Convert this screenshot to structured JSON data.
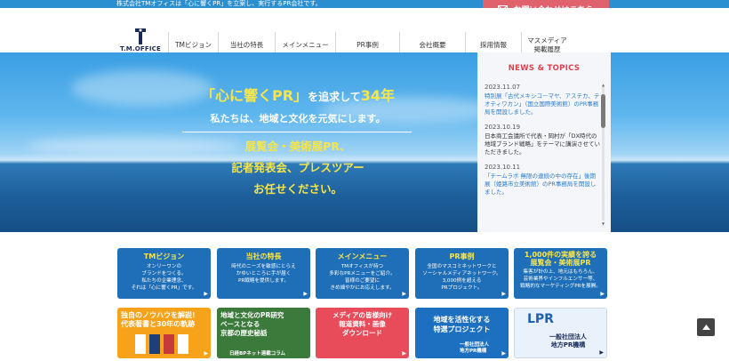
{
  "topbar": {
    "text": "株式会社TMオフィスは「心に響くPR」を立案し、実行するPR会社です。",
    "contact_label": "お問い合わせはこちら"
  },
  "logo": {
    "text": "T.M.OFFICE"
  },
  "nav": [
    {
      "label": "TMビジョン"
    },
    {
      "label": "当社の特長"
    },
    {
      "label": "メインメニュー"
    },
    {
      "label": "PR事例"
    },
    {
      "label": "会社概要"
    },
    {
      "label": "採用情報"
    },
    {
      "label": "マスメディア\n掲載履歴"
    }
  ],
  "hero": {
    "headline_pre": "「心に響くPR」",
    "headline_mid": "を追求して",
    "headline_post": "34年",
    "subline": "私たちは、地域と文化を元気にします。",
    "services": [
      "展覧会・美術展PR、",
      "記者発表会、プレスツアー",
      "お任せください。"
    ]
  },
  "news": {
    "title": "NEWS & TOPICS",
    "items": [
      {
        "date": "2023.11.07",
        "text": "特別展「古代メキシコ－マヤ、アステカ、テオティワカン」（国立国際美術館）のPR事務局を開設しました。",
        "link": true
      },
      {
        "date": "2023.10.19",
        "text": "日本商工会議所で代表・岡村が「DX時代の地域ブランド戦略」をテーマに講演させていただきました。",
        "link": false
      },
      {
        "date": "2023.10.11",
        "text": "「チームラボ 無限の連続の中の存在」後期展（姫路市立美術館）のPR事務局を開設しました。",
        "link": true
      }
    ]
  },
  "cards": [
    {
      "title": "TMビジョン",
      "body": "オンリーワンの\nブランドをつくる。\n私たちの企業理念、\nそれは「心に響くPR」です。"
    },
    {
      "title": "当社の特長",
      "body": "時代のニーズを敏感にとらえ\nかゆいところに手が届く\nPR戦略を提供します。"
    },
    {
      "title": "メインメニュー",
      "body": "TMオフィスが持つ\n多彩なPRメニューをご紹介。\n皆様のご要望に\nきめ細やかにお応えします。"
    },
    {
      "title": "PR事例",
      "body": "全国のマスコミネットワークと\nソーシャルメディアネットワーク。\n3,000例を超える\nPRプロジェクト。"
    },
    {
      "title": "1,000件の実績を誇る\n展覧会・美術展PR",
      "body": "集客が計の上、地元はもちろん、\n芸術業界やインフルエンサー等、\n戦略的なマーケティングPRを展開。"
    }
  ],
  "banners": [
    {
      "text": "独自のノウハウを解説!\n代表著書と30年の軌跡"
    },
    {
      "text": "地域と文化のPR研究\nベースとなる\n京都の歴史秘話",
      "sub": "日経BPネット連載コラム"
    },
    {
      "text": "メディアの皆様向け\n報道資料・画像\nダウンロード"
    },
    {
      "text": "地域を活性化する\n特選プロジェクト",
      "sub": "一般社団法人\n地方PR機構"
    },
    {
      "text": "一般社団法人\n地方PR機構"
    }
  ],
  "colors": {
    "accent_blue": "#2a8fd0",
    "contact_red": "#e0626c",
    "hero_yellow": "#f7e54a",
    "news_red": "#e0414d",
    "card_blue": "#1f6fb8"
  }
}
